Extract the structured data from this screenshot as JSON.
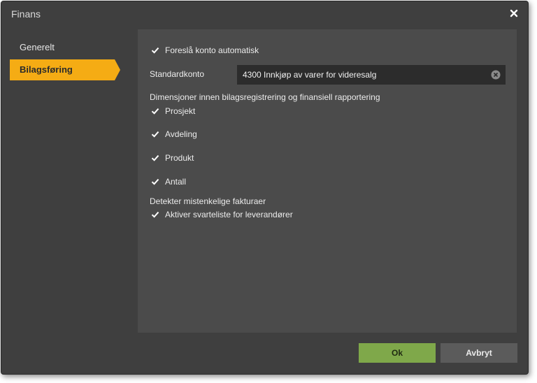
{
  "window": {
    "title": "Finans"
  },
  "sidebar": {
    "items": [
      {
        "label": "Generelt",
        "active": false
      },
      {
        "label": "Bilagsføring",
        "active": true
      }
    ]
  },
  "panel": {
    "suggest_account": {
      "label": "Foreslå konto automatisk",
      "checked": true
    },
    "standard_account": {
      "label": "Standardkonto",
      "value": "4300 Innkjøp av varer for videresalg"
    },
    "dimensions": {
      "heading": "Dimensjoner innen bilagsregistrering og finansiell rapportering",
      "items": [
        {
          "label": "Prosjekt",
          "checked": true
        },
        {
          "label": "Avdeling",
          "checked": true
        },
        {
          "label": "Produkt",
          "checked": true
        },
        {
          "label": "Antall",
          "checked": true
        }
      ]
    },
    "suspicious": {
      "heading": "Detekter mistenkelige fakturaer",
      "blacklist": {
        "label": "Aktiver svarteliste for leverandører",
        "checked": true
      }
    }
  },
  "buttons": {
    "ok": "Ok",
    "cancel": "Avbryt"
  },
  "colors": {
    "accent": "#f5ac14",
    "ok_button": "#7fa84a",
    "panel_bg": "#4b4b4b",
    "dialog_bg": "#3f3f3f"
  },
  "icons": {
    "close": "close-icon",
    "clear": "clear-icon",
    "check": "checkmark-icon"
  }
}
